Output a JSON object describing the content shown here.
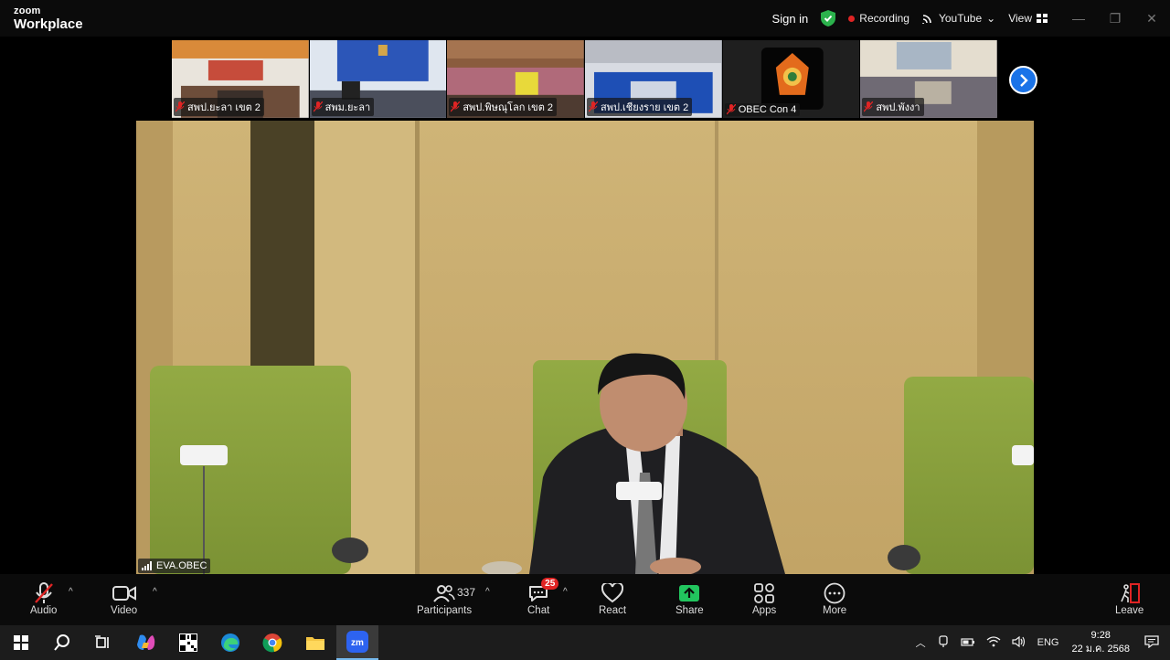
{
  "app": {
    "logo_small": "zoom",
    "logo_big": "Workplace"
  },
  "titlebar": {
    "sign_in": "Sign in",
    "recording": "Recording",
    "youtube": "YouTube",
    "view": "View"
  },
  "gallery": {
    "tiles": [
      {
        "name": "สพป.ยะลา เขต 2"
      },
      {
        "name": "สพม.ยะลา"
      },
      {
        "name": "สพป.พิษณุโลก เขต 2"
      },
      {
        "name": "สพป.เชียงราย เขต 2"
      },
      {
        "name": "OBEC Con 4"
      },
      {
        "name": "สพป.พังงา"
      }
    ]
  },
  "speaker": {
    "name": "EVA.OBEC"
  },
  "toolbar": {
    "audio": "Audio",
    "video": "Video",
    "participants": "Participants",
    "participant_count": "337",
    "chat": "Chat",
    "chat_badge": "25",
    "react": "React",
    "share": "Share",
    "apps": "Apps",
    "more": "More",
    "leave": "Leave"
  },
  "taskbar": {
    "language": "ENG",
    "time": "9:28",
    "date": "22 ม.ค. 2568",
    "zoom_label": "zm"
  },
  "colors": {
    "accent_blue": "#1a73e8",
    "recording_red": "#e02424",
    "share_green": "#22c55e",
    "wall": "#c9ad6f",
    "chair_green": "#8aa23c"
  }
}
